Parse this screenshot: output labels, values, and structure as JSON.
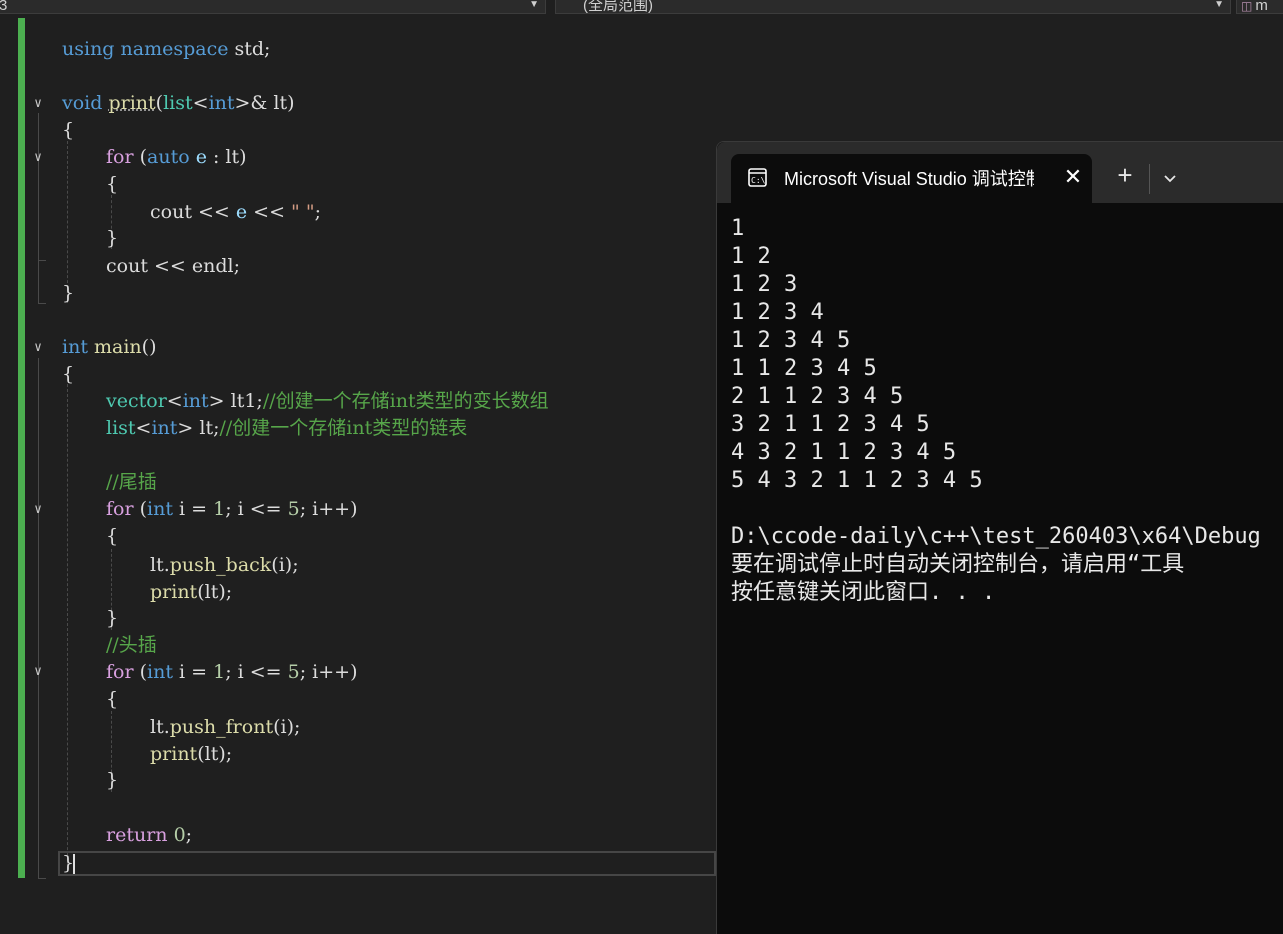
{
  "navbar": {
    "project_combo": "3",
    "scope_combo": "(全局范围)",
    "member_combo": "m"
  },
  "code": {
    "line1": {
      "kw1": "using",
      "kw2": "namespace",
      "rest": " std;"
    },
    "line3": {
      "kw": "void",
      "fn": "print",
      "p1": "(",
      "ty": "list",
      "p2": "<",
      "kw2": "int",
      "p3": ">& lt)"
    },
    "line4": "{",
    "line5": {
      "kw": "for",
      "p1": " (",
      "kw2": "auto",
      "var": " e",
      "p2": " : lt)"
    },
    "line6": "{",
    "line7": {
      "a": "cout << ",
      "var": "e",
      "b": " << ",
      "str": "\" \"",
      "c": ";"
    },
    "line8": "}",
    "line9": "cout << endl;",
    "line10": "}",
    "line12": {
      "kw": "int",
      "fn": "main",
      "p": "()"
    },
    "line13": "{",
    "line14": {
      "ty": "vector",
      "p1": "<",
      "kw": "int",
      "p2": "> lt1;",
      "cm": "//创建一个存储int类型的变长数组"
    },
    "line15": {
      "ty": "list",
      "p1": "<",
      "kw": "int",
      "p2": "> lt;",
      "cm": "//创建一个存储int类型的链表"
    },
    "line17": "//尾插",
    "line18": {
      "kw": "for",
      "p1": " (",
      "kw2": "int",
      "a": " i = ",
      "n1": "1",
      "b": "; i <= ",
      "n2": "5",
      "c": "; i++)"
    },
    "line19": "{",
    "line20": {
      "a": "lt.",
      "fn": "push_back",
      "b": "(i);"
    },
    "line21": {
      "fn": "print",
      "b": "(lt);"
    },
    "line22": "}",
    "line23": "//头插",
    "line24": {
      "kw": "for",
      "p1": " (",
      "kw2": "int",
      "a": " i = ",
      "n1": "1",
      "b": "; i <= ",
      "n2": "5",
      "c": "; i++)"
    },
    "line25": "{",
    "line26": {
      "a": "lt.",
      "fn": "push_front",
      "b": "(i);"
    },
    "line27": {
      "fn": "print",
      "b": "(lt);"
    },
    "line28": "}",
    "line30": {
      "kw": "return",
      "sp": " ",
      "n": "0",
      "b": ";"
    },
    "line31": "}"
  },
  "console": {
    "tab_title": "Microsoft Visual Studio 调试控制台",
    "close_glyph": "✕",
    "new_tab_glyph": "+",
    "output": [
      "1",
      "1 2",
      "1 2 3",
      "1 2 3 4",
      "1 2 3 4 5",
      "1 1 2 3 4 5",
      "2 1 1 2 3 4 5",
      "3 2 1 1 2 3 4 5",
      "4 3 2 1 1 2 3 4 5",
      "5 4 3 2 1 1 2 3 4 5",
      "",
      "D:\\ccode-daily\\c++\\test_260403\\x64\\Debug",
      "要在调试停止时自动关闭控制台，请启用“工具",
      "按任意键关闭此窗口. . ."
    ]
  },
  "colors": {
    "editor_bg": "#1f1f1f",
    "console_bg": "#0c0c0c",
    "keyword": "#569cd6",
    "control": "#d8a0df",
    "type": "#4ec9b0",
    "function": "#dcdcaa",
    "comment": "#57a64a",
    "change_bar": "#4caf50"
  }
}
